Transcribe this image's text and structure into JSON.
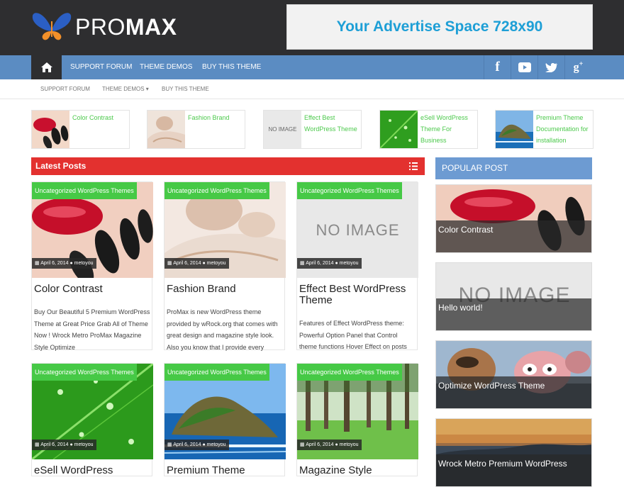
{
  "header": {
    "logo_light": "PRO",
    "logo_bold": "MAX",
    "ad_text": "Your Advertise Space 728x90"
  },
  "mainnav": {
    "home_icon": "home-icon",
    "items": [
      "SUPPORT FORUM",
      "THEME DEMOS",
      "BUY THIS THEME"
    ],
    "social": [
      "facebook-icon",
      "youtube-icon",
      "twitter-icon",
      "googleplus-icon"
    ]
  },
  "subnav": {
    "items": [
      "SUPPORT FORUM",
      "THEME DEMOS ▾",
      "BUY THIS THEME"
    ]
  },
  "featured": [
    {
      "title": "Color Contrast"
    },
    {
      "title": "Fashion Brand"
    },
    {
      "title": "Effect Best WordPress Theme",
      "noimage": "NO IMAGE"
    },
    {
      "title": "eSell WordPress Theme For Business"
    },
    {
      "title": "Premium Theme Documentation for installation"
    }
  ],
  "latest": {
    "heading": "Latest Posts"
  },
  "cards": [
    {
      "cats": "Uncategorized  WordPress Themes",
      "date": "April 6, 2014",
      "author": "metoyou",
      "title": "Color Contrast",
      "excerpt": "Buy Our Beautiful 5 Premium WordPress Theme at Great Price Grab All of Theme Now ! Wrock Metro ProMax Magazine Style Optimize"
    },
    {
      "cats": "Uncategorized  WordPress Themes",
      "date": "April 6, 2014",
      "author": "metoyou",
      "title": "Fashion Brand",
      "excerpt": "ProMax is new WordPress theme provided by wRock.org that comes with great design and magazine style look. Also you know that I provide every"
    },
    {
      "cats": "Uncategorized  WordPress Themes",
      "date": "April 6, 2014",
      "author": "metoyou",
      "title": "Effect Best WordPress Theme",
      "excerpt": "Features of Effect WordPress theme: Powerful Option Panel that Control theme functions Hover Effect on posts",
      "noimage": "NO IMAGE"
    },
    {
      "cats": "Uncategorized  WordPress Themes",
      "date": "April 6, 2014",
      "author": "metoyou",
      "title": "eSell WordPress"
    },
    {
      "cats": "Uncategorized  WordPress Themes",
      "date": "April 6, 2014",
      "author": "metoyou",
      "title": "Premium Theme"
    },
    {
      "cats": "Uncategorized  WordPress Themes",
      "date": "April 6, 2014",
      "author": "metoyou",
      "title": "Magazine Style"
    }
  ],
  "sidebar": {
    "heading": "POPULAR POST",
    "items": [
      {
        "caption": "Color Contrast"
      },
      {
        "caption": "Hello world!",
        "noimage": "NO IMAGE"
      },
      {
        "caption": "Optimize WordPress Theme"
      },
      {
        "caption": "Wrock Metro Premium WordPress"
      }
    ]
  }
}
